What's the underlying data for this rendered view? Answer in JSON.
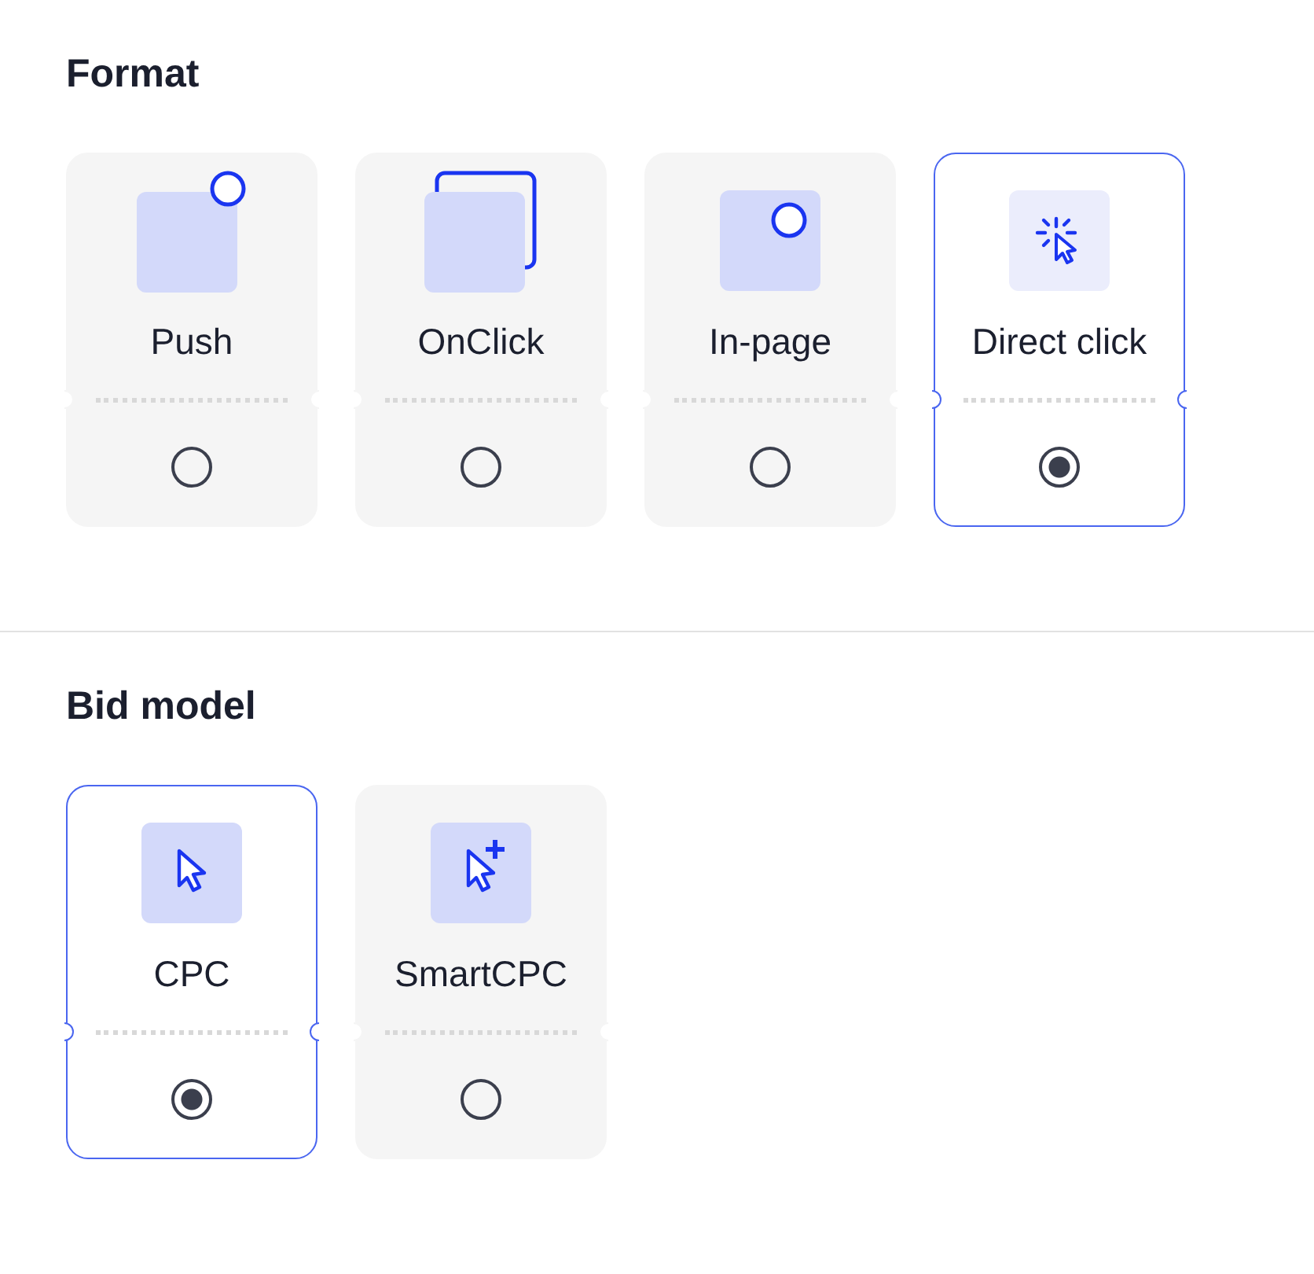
{
  "sections": [
    {
      "title": "Format",
      "options": [
        {
          "kind": "push",
          "label": "Push",
          "selected": false
        },
        {
          "kind": "onclick",
          "label": "OnClick",
          "selected": false
        },
        {
          "kind": "inpage",
          "label": "In-page",
          "selected": false
        },
        {
          "kind": "directclick",
          "label": "Direct click",
          "selected": true
        }
      ]
    },
    {
      "title": "Bid model",
      "options": [
        {
          "kind": "cursor",
          "label": "CPC",
          "selected": true
        },
        {
          "kind": "cursor-plus",
          "label": "SmartCPC",
          "selected": false
        }
      ]
    }
  ]
}
